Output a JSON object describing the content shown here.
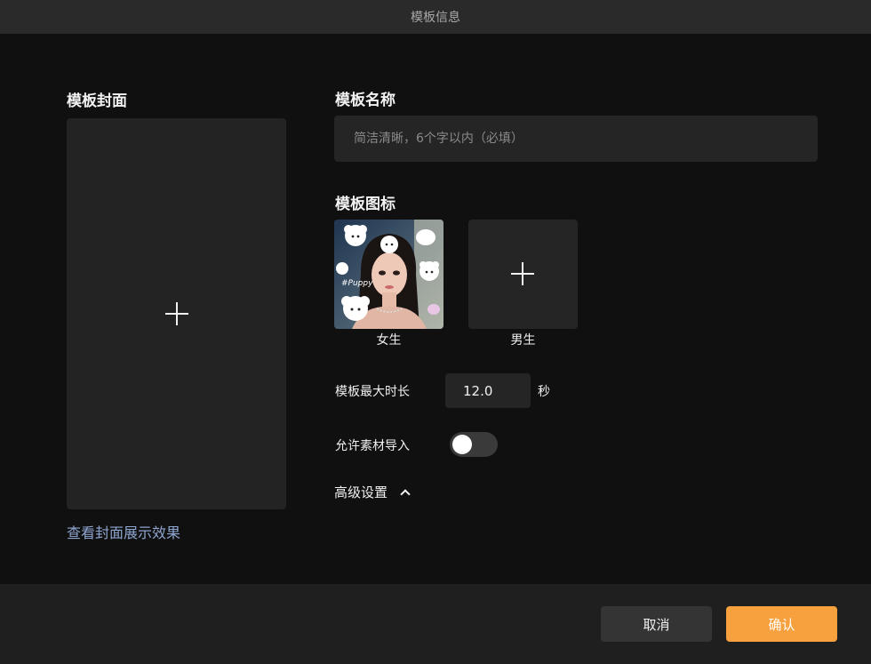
{
  "window": {
    "title": "模板信息"
  },
  "cover": {
    "label": "模板封面",
    "preview_link": "查看封面展示效果"
  },
  "name": {
    "label": "模板名称",
    "value": "",
    "placeholder": "简洁清晰，6个字以内（必填）"
  },
  "icons": {
    "label": "模板图标",
    "female": {
      "caption": "女生",
      "image_text": "#Puppy"
    },
    "male": {
      "caption": "男生"
    }
  },
  "duration": {
    "label": "模板最大时长",
    "value": "12.0",
    "unit": "秒"
  },
  "allow_import": {
    "label": "允许素材导入",
    "enabled": false
  },
  "advanced": {
    "label": "高级设置"
  },
  "footer": {
    "cancel_label": "取消",
    "confirm_label": "确认"
  },
  "colors": {
    "accent": "#f7a13e",
    "link": "#8ea5cf",
    "panel": "#101010",
    "field": "#252525"
  }
}
